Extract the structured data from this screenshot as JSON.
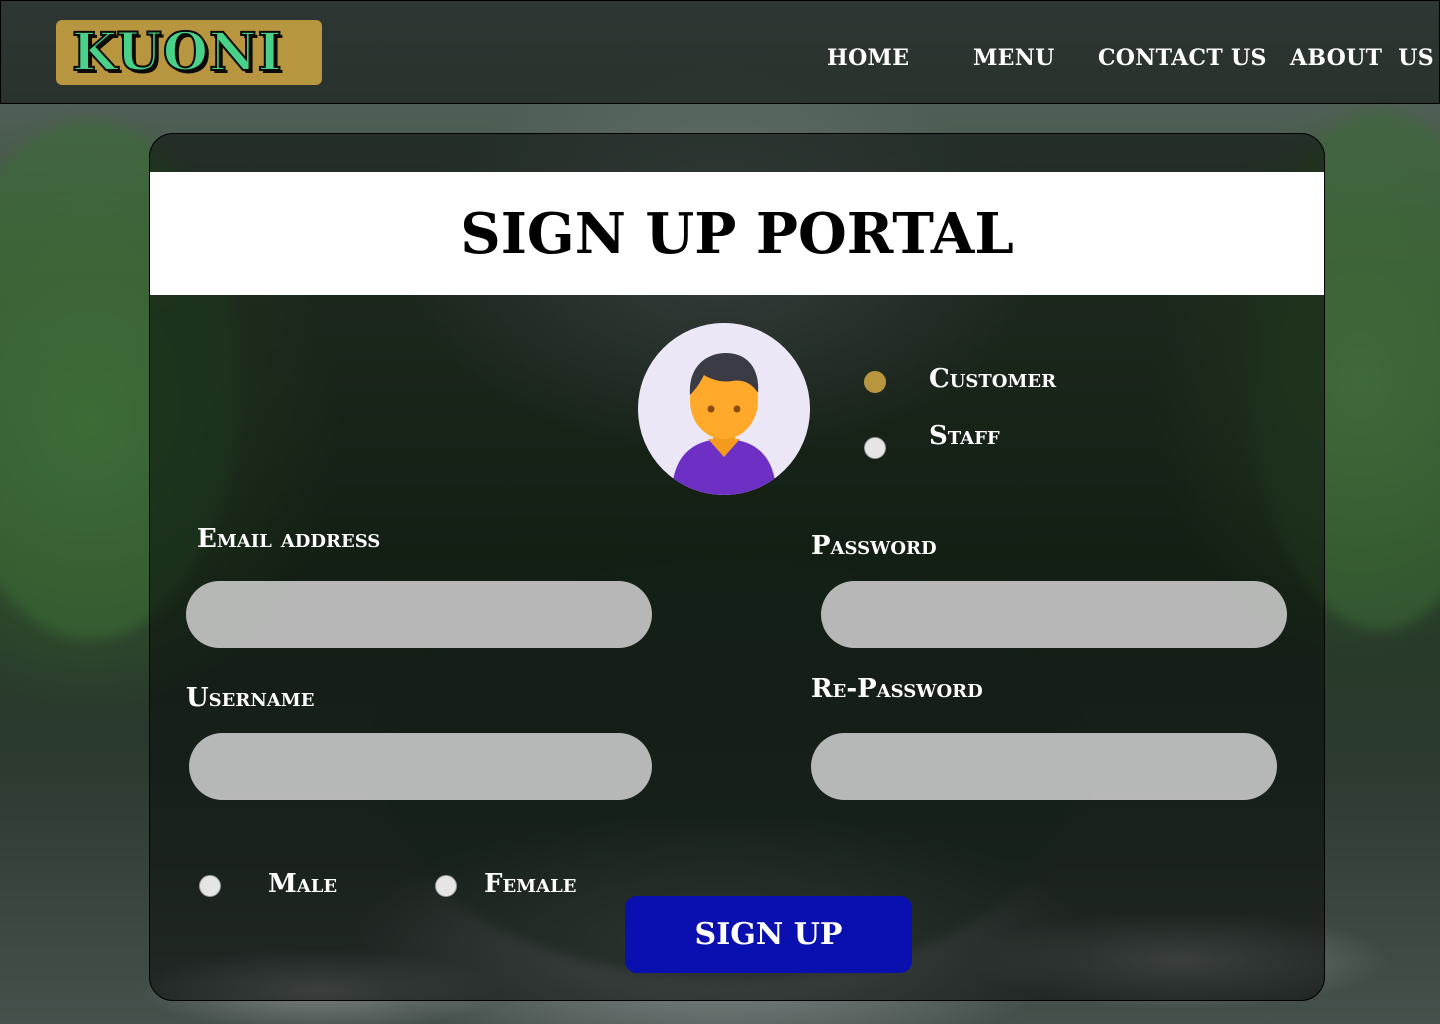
{
  "nav": {
    "logo": "KUONI",
    "links": [
      "HOME",
      "MENU",
      "CONTACT US",
      "ABOUT  US"
    ]
  },
  "form": {
    "title": "SIGN UP PORTAL",
    "role_options": [
      {
        "label": "Customer",
        "selected": true
      },
      {
        "label": "Staff",
        "selected": false
      }
    ],
    "email_label": "Email address",
    "email_value": "",
    "password_label": "Password",
    "password_value": "",
    "username_label": "Username",
    "username_value": "",
    "repassword_label": "Re-Password",
    "repassword_value": "",
    "gender_options": [
      {
        "label": "Male",
        "selected": false
      },
      {
        "label": "Female",
        "selected": false
      }
    ],
    "submit_label": "SIGN UP"
  },
  "colors": {
    "brand_gold": "#b8953f",
    "logo_green": "#49d18a",
    "submit_blue": "#0a0fb0",
    "field_grey": "#cdcdcd"
  },
  "icons": {
    "avatar": "user-avatar-icon"
  }
}
